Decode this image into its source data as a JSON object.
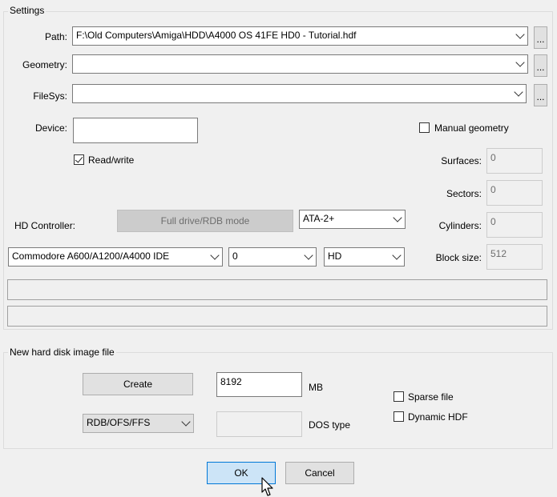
{
  "settings": {
    "title": "Settings",
    "path_label": "Path:",
    "path_value": "F:\\Old Computers\\Amiga\\HDD\\A4000 OS 41FE HD0 - Tutorial.hdf",
    "geometry_label": "Geometry:",
    "geometry_value": "",
    "filesys_label": "FileSys:",
    "filesys_value": "",
    "browse_label": "...",
    "device_label": "Device:",
    "device_value": "",
    "read_write_label": "Read/write",
    "read_write_checked": true,
    "manual_geometry_label": "Manual geometry",
    "manual_geometry_checked": false,
    "surfaces_label": "Surfaces:",
    "surfaces_value": "0",
    "sectors_label": "Sectors:",
    "sectors_value": "0",
    "cylinders_label": "Cylinders:",
    "cylinders_value": "0",
    "block_size_label": "Block size:",
    "block_size_value": "512",
    "hd_controller_label": "HD Controller:",
    "full_drive_label": "Full drive/RDB mode",
    "ata_value": "ATA-2+",
    "controller_value": "Commodore A600/A1200/A4000 IDE",
    "unit_value": "0",
    "type_value": "HD",
    "info_line1": "",
    "info_line2": ""
  },
  "new_image": {
    "title": "New hard disk image file",
    "create_label": "Create",
    "size_value": "8192",
    "size_unit": "MB",
    "format_value": "RDB/OFS/FFS",
    "dostype_value": "",
    "dostype_label": "DOS type",
    "sparse_label": "Sparse file",
    "sparse_checked": false,
    "dynamic_label": "Dynamic HDF",
    "dynamic_checked": false
  },
  "footer": {
    "ok_label": "OK",
    "cancel_label": "Cancel"
  }
}
